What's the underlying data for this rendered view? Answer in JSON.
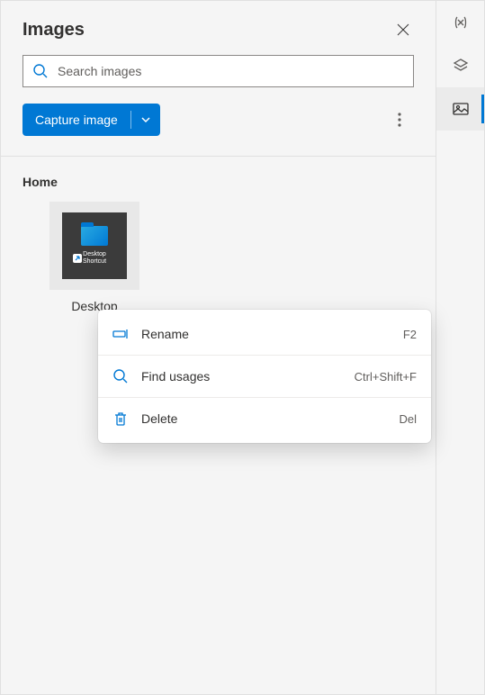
{
  "header": {
    "title": "Images"
  },
  "search": {
    "placeholder": "Search images",
    "value": ""
  },
  "toolbar": {
    "capture_label": "Capture image"
  },
  "section": {
    "title": "Home"
  },
  "thumbnails": [
    {
      "inner_label_line1": "Desktop",
      "inner_label_line2": "Shortcut",
      "caption": "Desktop"
    }
  ],
  "context_menu": {
    "items": [
      {
        "label": "Rename",
        "shortcut": "F2",
        "icon": "rename-icon"
      },
      {
        "label": "Find usages",
        "shortcut": "Ctrl+Shift+F",
        "icon": "search-icon"
      },
      {
        "label": "Delete",
        "shortcut": "Del",
        "icon": "trash-icon"
      }
    ]
  },
  "side_rail": {
    "items": [
      {
        "name": "variables-icon"
      },
      {
        "name": "layers-icon"
      },
      {
        "name": "images-icon",
        "active": true
      }
    ]
  }
}
